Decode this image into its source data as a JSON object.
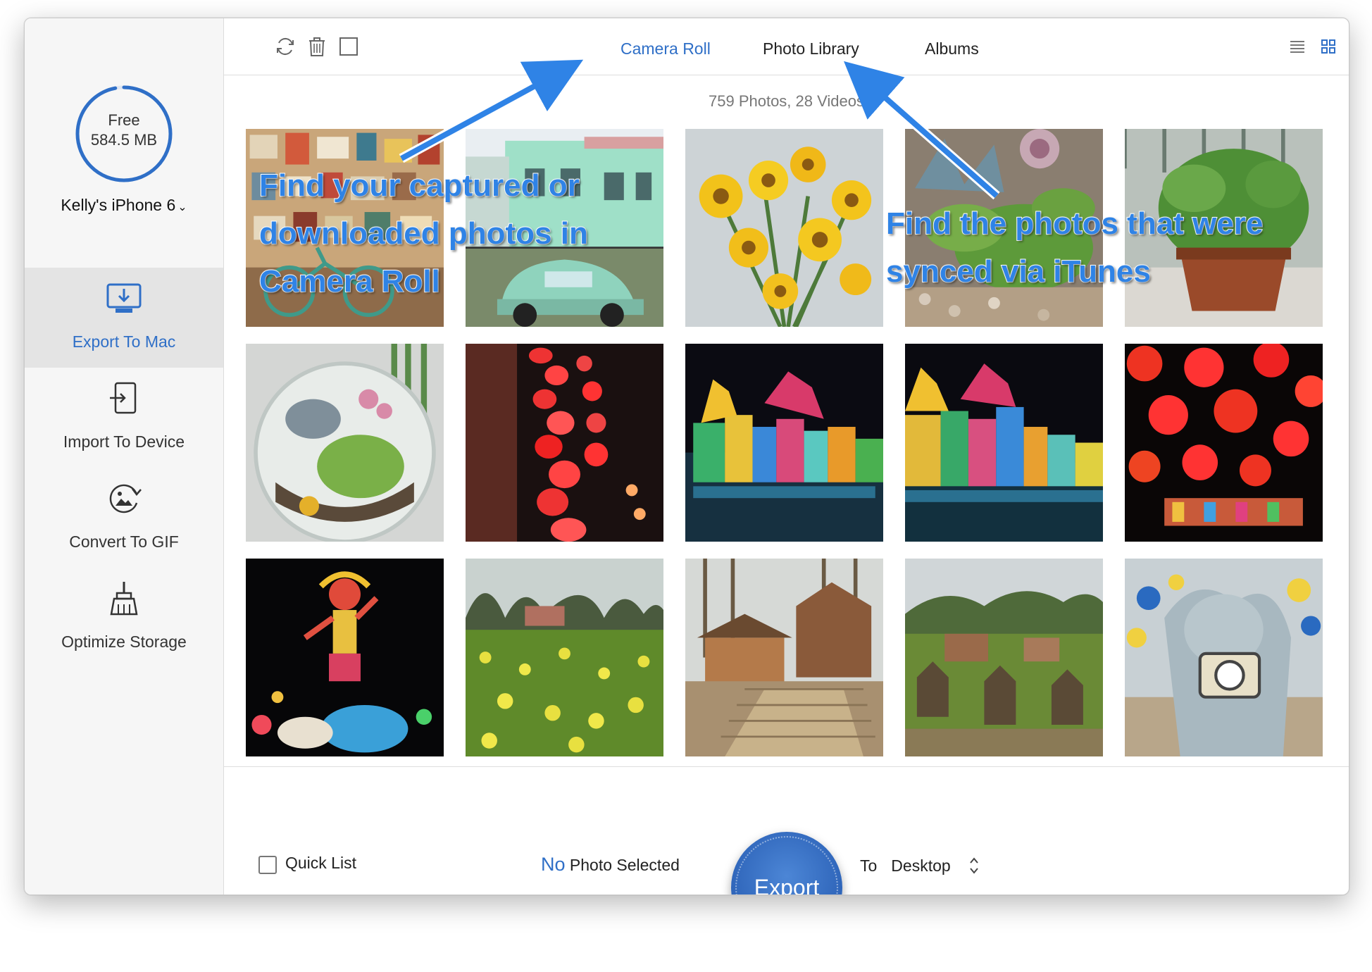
{
  "window": {
    "traffic_lights": [
      "close",
      "minimize"
    ]
  },
  "sidebar": {
    "storage": {
      "label": "Free",
      "value": "584.5 MB",
      "used_fraction": 0.97
    },
    "device": {
      "name": "Kelly's iPhone 6",
      "chevron": "⌄"
    },
    "items": [
      {
        "label": "Export To Mac",
        "icon": "export-to-mac-icon",
        "active": true
      },
      {
        "label": "Import To Device",
        "icon": "import-to-device-icon",
        "active": false
      },
      {
        "label": "Convert To GIF",
        "icon": "convert-gif-icon",
        "active": false
      },
      {
        "label": "Optimize Storage",
        "icon": "broom-icon",
        "active": false
      }
    ]
  },
  "toolbar": {
    "icons": [
      "refresh-icon",
      "trash-icon",
      "select-all-icon"
    ],
    "tabs": [
      {
        "label": "Camera Roll",
        "active": true
      },
      {
        "label": "Photo Library",
        "active": false
      },
      {
        "label": "Albums",
        "active": false
      }
    ],
    "view_icons": [
      "list-view-icon",
      "grid-view-icon"
    ]
  },
  "library": {
    "count_text": "759 Photos, 28 Videos",
    "photos": [
      "collage-wall-bicycle",
      "green-house-beetle",
      "yellow-gerberas",
      "succulents-rocks",
      "potted-mint",
      "terrarium-globe",
      "red-lanterns-column",
      "lantern-festival-horse",
      "lantern-festival-horse-2",
      "red-lanterns-night",
      "lantern-monkey-king",
      "rapeseed-field",
      "village-houses",
      "farm-scarecrows",
      "elephant-statue-pinwheels"
    ]
  },
  "footer": {
    "quick_list": "Quick List",
    "selection_no": "No",
    "selection_rest": " Photo Selected",
    "export_label": "Export",
    "to_label": "To",
    "destination": "Desktop"
  },
  "annotations": {
    "camera_roll_lines": [
      "Find your captured or",
      "downloaded photos in",
      "Camera Roll"
    ],
    "photo_library_lines": [
      "Find the photos that were",
      "synced via iTunes"
    ]
  },
  "colors": {
    "accent": "#2f6fc7",
    "callout": "#2f83e6",
    "sidebar_active": "#e4e4e4"
  }
}
